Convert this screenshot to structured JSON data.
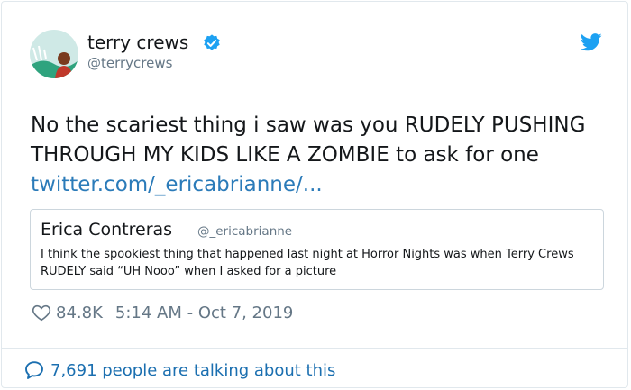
{
  "author": {
    "name": "terry crews",
    "handle": "@terrycrews",
    "verified": true
  },
  "tweet": {
    "text": "No the scariest thing i saw was you RUDELY PUSHING THROUGH MY KIDS LIKE A ZOMBIE to ask for one ",
    "link_text": "twitter.com/_ericabrianne/..."
  },
  "quoted": {
    "name": "Erica Contreras",
    "handle": "@_ericabrianne",
    "text": "I think the spookiest thing that happened last night at Horror Nights was when Terry Crews RUDELY said “UH Nooo” when I asked for a picture"
  },
  "meta": {
    "likes": "84.8K",
    "timestamp": "5:14 AM - Oct 7, 2019"
  },
  "footer": {
    "conversation": "7,691 people are talking about this"
  },
  "colors": {
    "brand_blue": "#1da1f2",
    "link_blue": "#2b7bb9",
    "muted": "#657786",
    "border": "#e1e8ed"
  },
  "icons": [
    "avatar",
    "verified-badge-icon",
    "twitter-bird-icon",
    "heart-icon",
    "speech-bubble-icon"
  ]
}
